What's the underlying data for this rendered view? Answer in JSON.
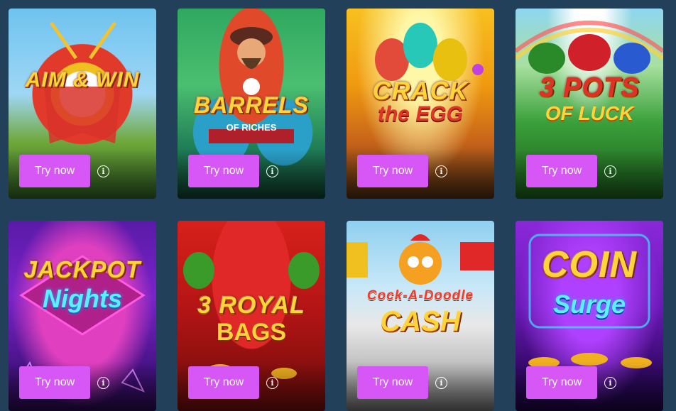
{
  "games": [
    {
      "title": "AIM & WIN",
      "subtitle": "",
      "button_label": "Try now",
      "info_icon": "info-icon"
    },
    {
      "title": "BARRELS",
      "subtitle": "OF RICHES",
      "button_label": "Try now",
      "info_icon": "info-icon"
    },
    {
      "title": "CRACK",
      "subtitle": "the EGG",
      "button_label": "Try now",
      "info_icon": "info-icon"
    },
    {
      "title": "3 POTS",
      "subtitle": "OF LUCK",
      "button_label": "Try now",
      "info_icon": "info-icon"
    },
    {
      "title": "JACKPOT",
      "subtitle": "Nights",
      "button_label": "Try now",
      "info_icon": "info-icon"
    },
    {
      "title": "3 ROYAL",
      "subtitle": "BAGS",
      "button_label": "Try now",
      "info_icon": "info-icon"
    },
    {
      "title": "Cock-A-Doodle",
      "subtitle": "CASH",
      "button_label": "Try now",
      "info_icon": "info-icon"
    },
    {
      "title": "COIN",
      "subtitle": "Surge",
      "button_label": "Try now",
      "info_icon": "info-icon"
    }
  ],
  "colors": {
    "page_background": "#22405a",
    "button_background": "#d657f5",
    "button_text": "#ffffff"
  }
}
